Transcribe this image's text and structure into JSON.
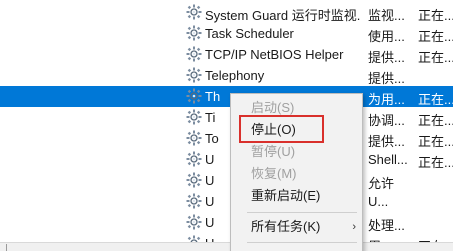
{
  "services": [
    {
      "name": "System Guard 运行时监视...",
      "desc": "监视...",
      "status": "正在...",
      "selected": false
    },
    {
      "name": "Task Scheduler",
      "desc": "使用...",
      "status": "正在...",
      "selected": false
    },
    {
      "name": "TCP/IP NetBIOS Helper",
      "desc": "提供...",
      "status": "正在...",
      "selected": false
    },
    {
      "name": "Telephony",
      "desc": "提供...",
      "status": "",
      "selected": false
    },
    {
      "name": "Th",
      "desc": "为用...",
      "status": "正在...",
      "selected": true
    },
    {
      "name": "Ti",
      "desc": "协调...",
      "status": "正在...",
      "selected": false
    },
    {
      "name": "To",
      "desc": "提供...",
      "status": "正在...",
      "selected": false
    },
    {
      "name": "U",
      "desc": "Shell...",
      "status": "正在...",
      "selected": false
    },
    {
      "name": "U",
      "desc": "允许",
      "status": "",
      "selected": false
    },
    {
      "name": "U",
      "desc": "U...",
      "status": "",
      "selected": false
    },
    {
      "name": "U",
      "desc": "处理...",
      "status": "",
      "selected": false
    },
    {
      "name": "U",
      "desc": "用...",
      "status": "正在...",
      "selected": false
    }
  ],
  "context_menu": {
    "start": "启动(S)",
    "stop": "停止(O)",
    "pause": "暂停(U)",
    "resume": "恢复(M)",
    "restart": "重新启动(E)",
    "all_tasks": "所有任务(K)",
    "submenu_arrow": "›"
  },
  "colors": {
    "selection": "#0078d7",
    "highlight_box": "#d9302c",
    "menu_bg": "#f2f2f2"
  },
  "icons": {
    "service": "gear-icon"
  }
}
